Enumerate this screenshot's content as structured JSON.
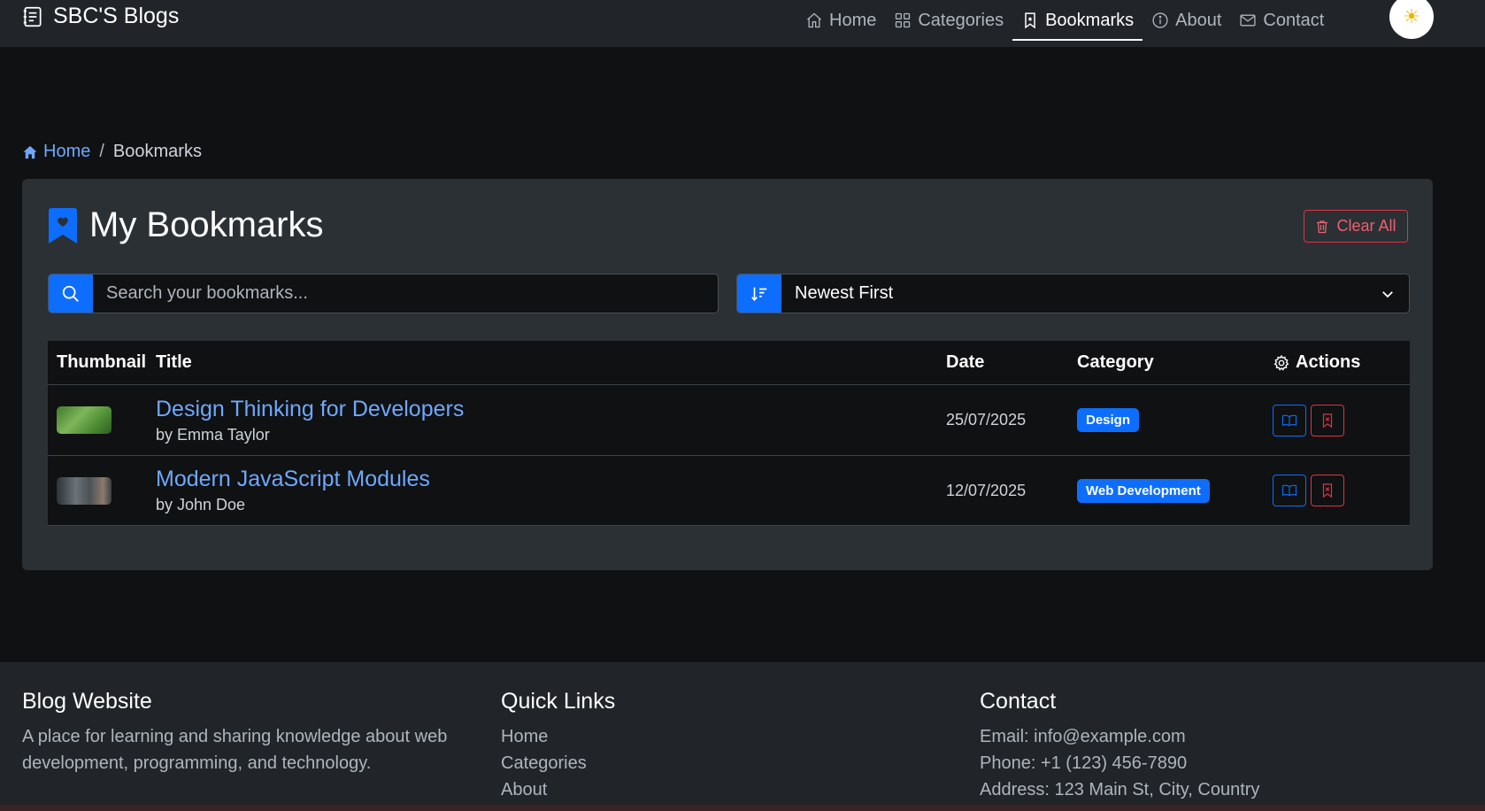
{
  "navbar": {
    "brand": "SBC'S Blogs",
    "items": [
      {
        "label": "Home",
        "icon": "house-icon"
      },
      {
        "label": "Categories",
        "icon": "grid-icon"
      },
      {
        "label": "Bookmarks",
        "icon": "bookmark-icon",
        "active": true
      },
      {
        "label": "About",
        "icon": "info-icon"
      },
      {
        "label": "Contact",
        "icon": "envelope-icon"
      }
    ],
    "theme_icon": "☀"
  },
  "breadcrumb": {
    "home": "Home",
    "separator": "/",
    "current": "Bookmarks"
  },
  "card": {
    "title": "My Bookmarks",
    "clear_all": "Clear All",
    "search_placeholder": "Search your bookmarks...",
    "sort_value": "Newest First"
  },
  "table": {
    "headers": {
      "thumbnail": "Thumbnail",
      "title": "Title",
      "date": "Date",
      "category": "Category",
      "actions": "Actions"
    },
    "rows": [
      {
        "title": "Design Thinking for Developers",
        "author": "by Emma Taylor",
        "date": "25/07/2025",
        "category": "Design"
      },
      {
        "title": "Modern JavaScript Modules",
        "author": "by John Doe",
        "date": "12/07/2025",
        "category": "Web Development"
      }
    ]
  },
  "footer": {
    "about": {
      "heading": "Blog Website",
      "text": "A place for learning and sharing knowledge about web development, programming, and technology."
    },
    "links": {
      "heading": "Quick Links",
      "items": [
        "Home",
        "Categories",
        "About"
      ]
    },
    "contact": {
      "heading": "Contact",
      "email": "Email: info@example.com",
      "phone": "Phone: +1 (123) 456-7890",
      "address": "Address: 123 Main St, City, Country"
    }
  },
  "colors": {
    "accent": "#0d6efd",
    "link": "#6ea8fe",
    "danger": "#dc3545",
    "background": "#101112",
    "card": "#2b3035",
    "navbar": "#212529"
  }
}
